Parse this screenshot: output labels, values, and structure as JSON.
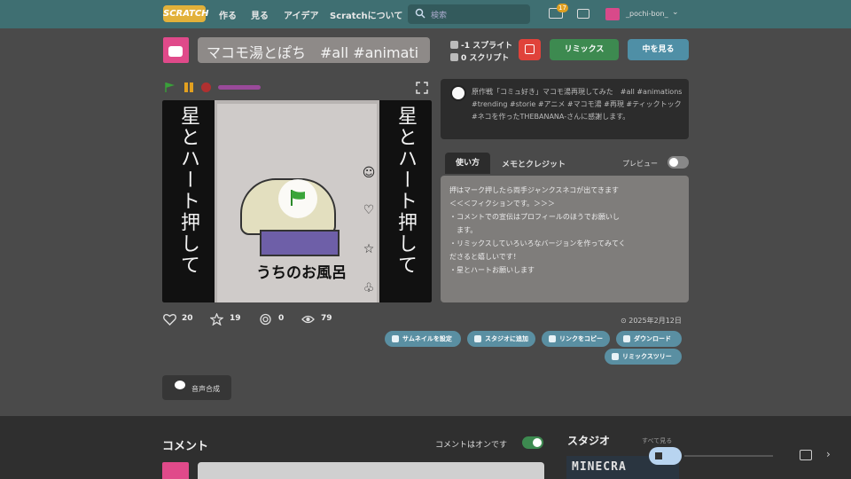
{
  "nav": {
    "logo": "SCRATCH",
    "items": [
      "作る",
      "見る",
      "アイデア",
      "Scratchについて"
    ],
    "search_placeholder": "検索",
    "messages_count": "17",
    "username": "_pochi-bon_"
  },
  "project": {
    "title": "マコモ湯とぽち　#all #animati",
    "sprites": "-1 スプライト",
    "scripts": "0 スクリプト",
    "remix_label": "リミックス",
    "see_inside_label": "中を見る"
  },
  "stage": {
    "left_text": "星とハート押して",
    "right_text": "星とハート押して",
    "caption": "うちのお風呂",
    "side_icons": [
      "☺",
      "♡",
      "☆",
      "♧"
    ]
  },
  "description": "原作戦「コミュ好き」マコモ湯再現してみた　#all #animations #trending #storie #アニメ #マコモ湯 #再現 #ティックトック #ネコを作ったTHEBANANA-さんに感謝します。",
  "tabs": {
    "instructions": "使い方",
    "notes": "メモとクレジット",
    "preview": "プレビュー"
  },
  "instructions_lines": [
    "押はマーク押したら両手ジャンクスネコが出てきます",
    "",
    "＜＜＜フィクションです。＞＞＞",
    "・コメントでの宣伝はプロフィールのほうでお願いし",
    "　ます。",
    "・リミックスしていろいろなバージョンを作ってみてく",
    "ださると嬉しいです！",
    "・星とハートお願いします"
  ],
  "stats": {
    "loves": "20",
    "favorites": "19",
    "remixes": "0",
    "views": "79",
    "date": "⊙ 2025年2月12日"
  },
  "actions": {
    "thumbnail": "サムネイルを設定",
    "add_studio": "スタジオに追加",
    "copy_link": "リンクをコピー",
    "download": "ダウンロード",
    "remix_tree": "リミックスツリー"
  },
  "tts_label": "音声合成",
  "comments": {
    "title": "コメント",
    "on_label": "コメントはオンです"
  },
  "studio": {
    "title": "スタジオ",
    "more": "すべて見る",
    "thumb_text": "MINECRA"
  }
}
